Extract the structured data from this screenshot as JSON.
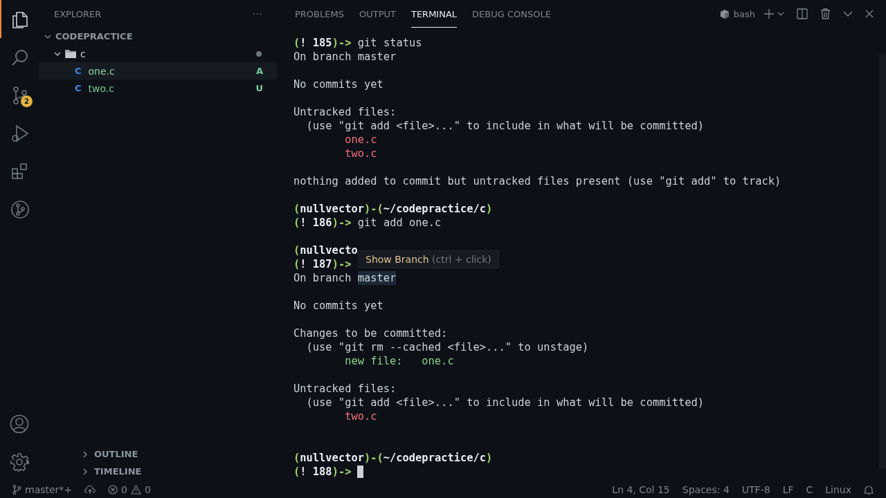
{
  "activity_bar": [
    {
      "kind": "files",
      "selected": true
    },
    {
      "kind": "search",
      "selected": false
    },
    {
      "kind": "scm",
      "selected": false,
      "badge": "2"
    },
    {
      "kind": "debug",
      "selected": false
    },
    {
      "kind": "extensions",
      "selected": false
    },
    {
      "kind": "graph",
      "selected": false
    }
  ],
  "explorer": {
    "title": "EXPLORER",
    "more": "···",
    "tree": [
      {
        "label": "CODEPRACTICE",
        "kind": "root",
        "expanded": true,
        "children": [
          {
            "label": "c",
            "kind": "folder",
            "expanded": true,
            "modified": true,
            "children": [
              {
                "label": "one.c",
                "kind": "file",
                "icon": "C",
                "status": "A",
                "selected": true
              },
              {
                "label": "two.c",
                "kind": "file",
                "icon": "C",
                "status": "U",
                "selected": false
              }
            ]
          }
        ]
      }
    ],
    "sections": [
      {
        "label": "OUTLINE",
        "expanded": false
      },
      {
        "label": "TIMELINE",
        "expanded": false
      }
    ]
  },
  "panel": {
    "tabs": [
      {
        "label": "PROBLEMS",
        "selected": false
      },
      {
        "label": "OUTPUT",
        "selected": false
      },
      {
        "label": "TERMINAL",
        "selected": true
      },
      {
        "label": "DEBUG CONSOLE",
        "selected": false
      }
    ],
    "shell": "bash"
  },
  "terminal": {
    "lines": [
      {
        "kind": "cmd",
        "open": "(",
        "num": "! 185",
        "close": ")->",
        "command": "git status"
      },
      {
        "kind": "out",
        "text": "On branch master"
      },
      {
        "kind": "blank"
      },
      {
        "kind": "out",
        "text": "No commits yet"
      },
      {
        "kind": "blank"
      },
      {
        "kind": "out",
        "text": "Untracked files:"
      },
      {
        "kind": "out",
        "text": "  (use \"git add <file>...\" to include in what will be committed)"
      },
      {
        "kind": "untracked",
        "text": "        one.c"
      },
      {
        "kind": "untracked",
        "text": "        two.c"
      },
      {
        "kind": "blank"
      },
      {
        "kind": "out",
        "text": "nothing added to commit but untracked files present (use \"git add\" to track)"
      },
      {
        "kind": "blank"
      },
      {
        "kind": "head",
        "open": "(",
        "user": "nullvector",
        "sep": ")-(",
        "path": "~/codepractice/c",
        "close": ")"
      },
      {
        "kind": "cmd",
        "open": "(",
        "num": "! 186",
        "close": ")->",
        "command": "git add one.c"
      },
      {
        "kind": "blank"
      },
      {
        "kind": "head",
        "open": "(",
        "user": "nullvecto"
      },
      {
        "kind": "cmd",
        "open": "(",
        "num": "! 187",
        "close": ")->"
      },
      {
        "kind": "out",
        "text": "On branch ",
        "link": "master"
      },
      {
        "kind": "blank"
      },
      {
        "kind": "out",
        "text": "No commits yet"
      },
      {
        "kind": "blank"
      },
      {
        "kind": "out",
        "text": "Changes to be committed:"
      },
      {
        "kind": "out",
        "text": "  (use \"git rm --cached <file>...\" to unstage)"
      },
      {
        "kind": "staged",
        "text": "        new file:   one.c"
      },
      {
        "kind": "blank"
      },
      {
        "kind": "out",
        "text": "Untracked files:"
      },
      {
        "kind": "out",
        "text": "  (use \"git add <file>...\" to include in what will be committed)"
      },
      {
        "kind": "untracked",
        "text": "        two.c"
      },
      {
        "kind": "blank"
      },
      {
        "kind": "blank"
      },
      {
        "kind": "head",
        "open": "(",
        "user": "nullvector",
        "sep": ")-(",
        "path": "~/codepractice/c",
        "close": ")"
      },
      {
        "kind": "cmd",
        "open": "(",
        "num": "! 188",
        "close": ")->",
        "cursor": true
      }
    ],
    "tooltip": {
      "action": "Show Branch",
      "hint": "(ctrl + click)"
    }
  },
  "status_bar": {
    "branch": "master*+",
    "errors": "0",
    "warnings": "0",
    "items": [
      "Ln 4, Col 15",
      "Spaces: 4",
      "UTF-8",
      "LF",
      "C",
      "Linux"
    ]
  }
}
